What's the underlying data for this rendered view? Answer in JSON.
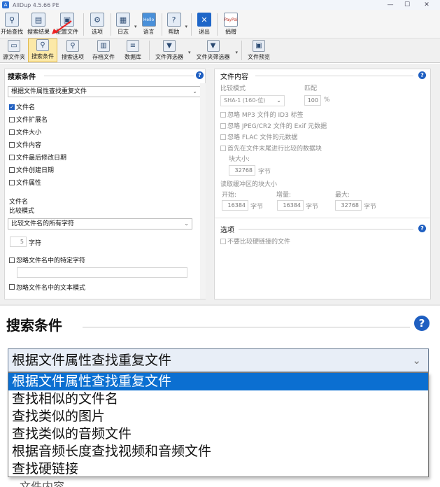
{
  "window": {
    "title": "AllDup 4.5.66 PE"
  },
  "toolbar1": [
    {
      "label": "开始查找",
      "icon": "magnifier-icon"
    },
    {
      "label": "搜索结果",
      "icon": "results-icon"
    },
    {
      "label": "配置文件",
      "icon": "profile-icon"
    },
    {
      "label": "选项",
      "icon": "options-icon"
    },
    {
      "label": "日志",
      "icon": "log-icon"
    },
    {
      "label": "语言",
      "icon": "hello-icon",
      "glyph": "Hello"
    },
    {
      "label": "帮助",
      "icon": "help-icon"
    },
    {
      "label": "退出",
      "icon": "exit-icon"
    },
    {
      "label": "捐赠",
      "icon": "paypal-icon",
      "glyph": "PayPal"
    }
  ],
  "toolbar2": [
    {
      "label": "源文件夹"
    },
    {
      "label": "搜索条件",
      "active": true
    },
    {
      "label": "搜索选项"
    },
    {
      "label": "存档文件"
    },
    {
      "label": "数据库"
    },
    {
      "label": "文件筛选器"
    },
    {
      "label": "文件夹筛选器"
    },
    {
      "label": "文件预览"
    }
  ],
  "left": {
    "title": "搜索条件",
    "method": "根据文件属性查找重复文件",
    "checks": [
      {
        "label": "文件名",
        "checked": true
      },
      {
        "label": "文件扩展名",
        "checked": false
      },
      {
        "label": "文件大小",
        "checked": false
      },
      {
        "label": "文件内容",
        "checked": false
      },
      {
        "label": "文件最后修改日期",
        "checked": false
      },
      {
        "label": "文件创建日期",
        "checked": false
      },
      {
        "label": "文件属性",
        "checked": false
      }
    ],
    "filename_heading": "文件名",
    "compare_mode_label": "比较模式",
    "compare_mode_value": "比较文件名的所有字符",
    "chars_value": "5",
    "chars_unit": "字符",
    "ignore_chars_label": "忽略文件名中的特定字符",
    "ignore_pattern_label": "忽略文件名中的文本模式"
  },
  "right": {
    "content_title": "文件内容",
    "compare_mode_label": "比较模式",
    "match_label": "匹配",
    "hash_value": "SHA-1 (160-位)",
    "match_value": "100",
    "match_unit": "%",
    "opts": [
      "忽略 MP3 文件的 ID3 标签",
      "忽略 JPEG/CR2 文件的 Exif 元数据",
      "忽略 FLAC 文件的元数据",
      "首先在文件末尾进行比较的数据块"
    ],
    "block_size_label": "块大小:",
    "block_size_value": "32768",
    "bytes": "字节",
    "buffer_label": "读取缓冲区的块大小",
    "start_label": "开始:",
    "start_value": "16384",
    "inc_label": "增量:",
    "inc_value": "16384",
    "max_label": "最大:",
    "max_value": "32768",
    "options_title": "选项",
    "hardlink_label": "不要比较硬链接的文件"
  },
  "zoom": {
    "title": "搜索条件",
    "selected": "根据文件属性查找重复文件",
    "items": [
      "根据文件属性查找重复文件",
      "查找相似的文件名",
      "查找类似的图片",
      "查找类似的音频文件",
      "根据音频长度查找视频和音频文件",
      "查找硬链接"
    ],
    "cut_text": "文件内容"
  },
  "colors": {
    "accent": "#1f5fc1",
    "selection": "#0b6fd1",
    "active_tab": "#fce9a8"
  }
}
